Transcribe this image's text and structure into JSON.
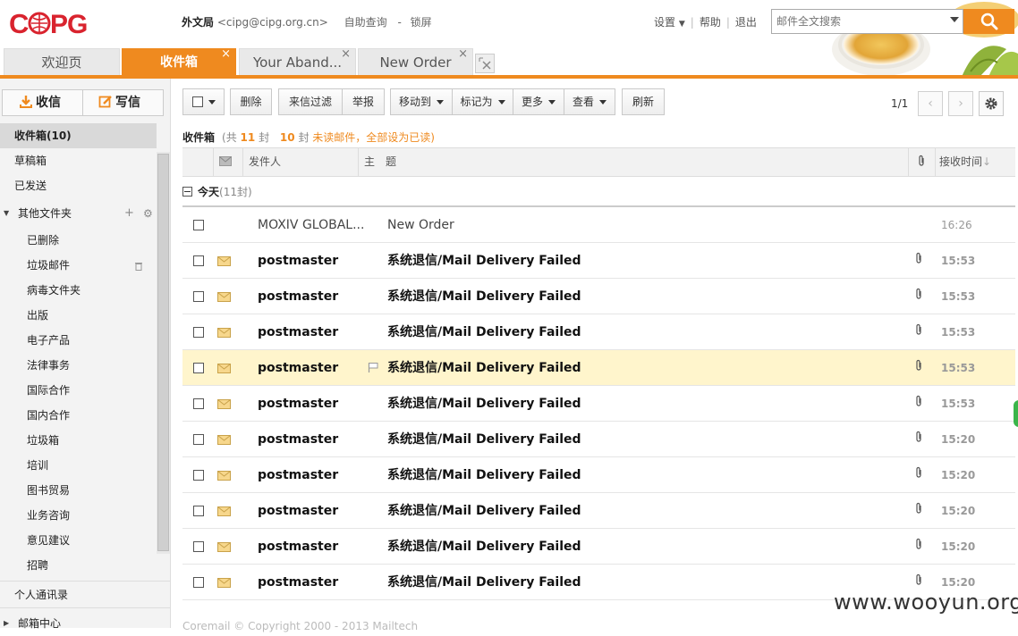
{
  "header": {
    "logo_text": "CIPG",
    "user_name": "外文局",
    "user_email": "<cipg@cipg.org.cn>",
    "self_service": "自助查询",
    "dash": "-",
    "lock": "锁屏",
    "settings": "设置",
    "help": "帮助",
    "logout": "退出",
    "search_placeholder": "邮件全文搜索"
  },
  "tabs": [
    {
      "label": "欢迎页"
    },
    {
      "label": "收件箱",
      "active": true
    },
    {
      "label": "Your Aband..."
    },
    {
      "label": "New Order"
    }
  ],
  "tab_close": "×",
  "sidebar": {
    "receive": "收信",
    "compose": "写信",
    "folders": {
      "inbox": "收件箱(10)",
      "drafts": "草稿箱",
      "sent": "已发送",
      "other": "其他文件夹",
      "personal_contacts": "个人通讯录",
      "mailbox_center": "邮箱中心"
    },
    "subfolders": [
      "已删除",
      "垃圾邮件",
      "病毒文件夹",
      "出版",
      "电子产品",
      "法律事务",
      "国际合作",
      "国内合作",
      "垃圾箱",
      "培训",
      "图书贸易",
      "业务咨询",
      "意见建议",
      "招聘"
    ]
  },
  "toolbar": {
    "delete": "删除",
    "filter": "来信过滤",
    "report": "举报",
    "move_to": "移动到",
    "mark_as": "标记为",
    "more": "更多",
    "view": "查看",
    "refresh": "刷新",
    "page_info": "1/1",
    "prev": "‹",
    "next": "›"
  },
  "summary": {
    "box_title": "收件箱",
    "total_prefix": "(共",
    "total_count": "11",
    "total_suffix": "封",
    "unread_count": "10",
    "unread_suffix": "封",
    "unread_label": "未读邮件",
    "mark_all_read": "，全部设为已读)"
  },
  "columns": {
    "sender": "发件人",
    "subject": "主　题",
    "time": "接收时间"
  },
  "group": {
    "name": "今天",
    "count": "(11封)"
  },
  "rows": [
    {
      "sender": "MOXIV GLOBAL...",
      "subject": "New Order",
      "time": "16:26",
      "unread": false,
      "attach": false
    },
    {
      "sender": "postmaster",
      "subject": "系统退信/Mail Delivery Failed",
      "time": "15:53",
      "unread": true,
      "attach": true
    },
    {
      "sender": "postmaster",
      "subject": "系统退信/Mail Delivery Failed",
      "time": "15:53",
      "unread": true,
      "attach": true
    },
    {
      "sender": "postmaster",
      "subject": "系统退信/Mail Delivery Failed",
      "time": "15:53",
      "unread": true,
      "attach": true
    },
    {
      "sender": "postmaster",
      "subject": "系统退信/Mail Delivery Failed",
      "time": "15:53",
      "unread": true,
      "attach": true,
      "highlight": true
    },
    {
      "sender": "postmaster",
      "subject": "系统退信/Mail Delivery Failed",
      "time": "15:53",
      "unread": true,
      "attach": true
    },
    {
      "sender": "postmaster",
      "subject": "系统退信/Mail Delivery Failed",
      "time": "15:20",
      "unread": true,
      "attach": true
    },
    {
      "sender": "postmaster",
      "subject": "系统退信/Mail Delivery Failed",
      "time": "15:20",
      "unread": true,
      "attach": true
    },
    {
      "sender": "postmaster",
      "subject": "系统退信/Mail Delivery Failed",
      "time": "15:20",
      "unread": true,
      "attach": true
    },
    {
      "sender": "postmaster",
      "subject": "系统退信/Mail Delivery Failed",
      "time": "15:20",
      "unread": true,
      "attach": true
    },
    {
      "sender": "postmaster",
      "subject": "系统退信/Mail Delivery Failed",
      "time": "15:20",
      "unread": true,
      "attach": true
    }
  ],
  "footer": "Coremail © Copyright 2000 - 2013 Mailtech",
  "watermark": "www.wooyun.org",
  "colors": {
    "accent": "#ef8a1f",
    "logo_red": "#d9232e",
    "highlight_row": "#fff5cc"
  }
}
